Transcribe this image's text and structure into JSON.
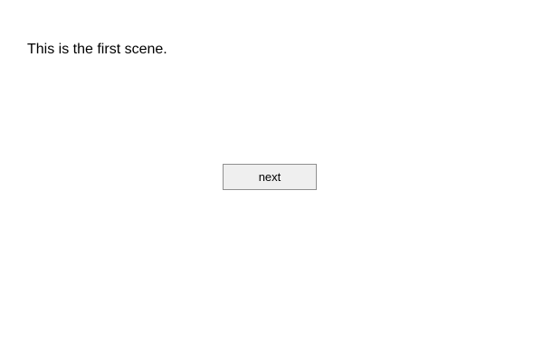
{
  "scene": {
    "text": "This is the first scene.",
    "next_label": "next"
  },
  "colors": {
    "background": "#ffffff",
    "text": "#000000",
    "button_background": "#efefef",
    "button_border": "#8f8f8f"
  }
}
